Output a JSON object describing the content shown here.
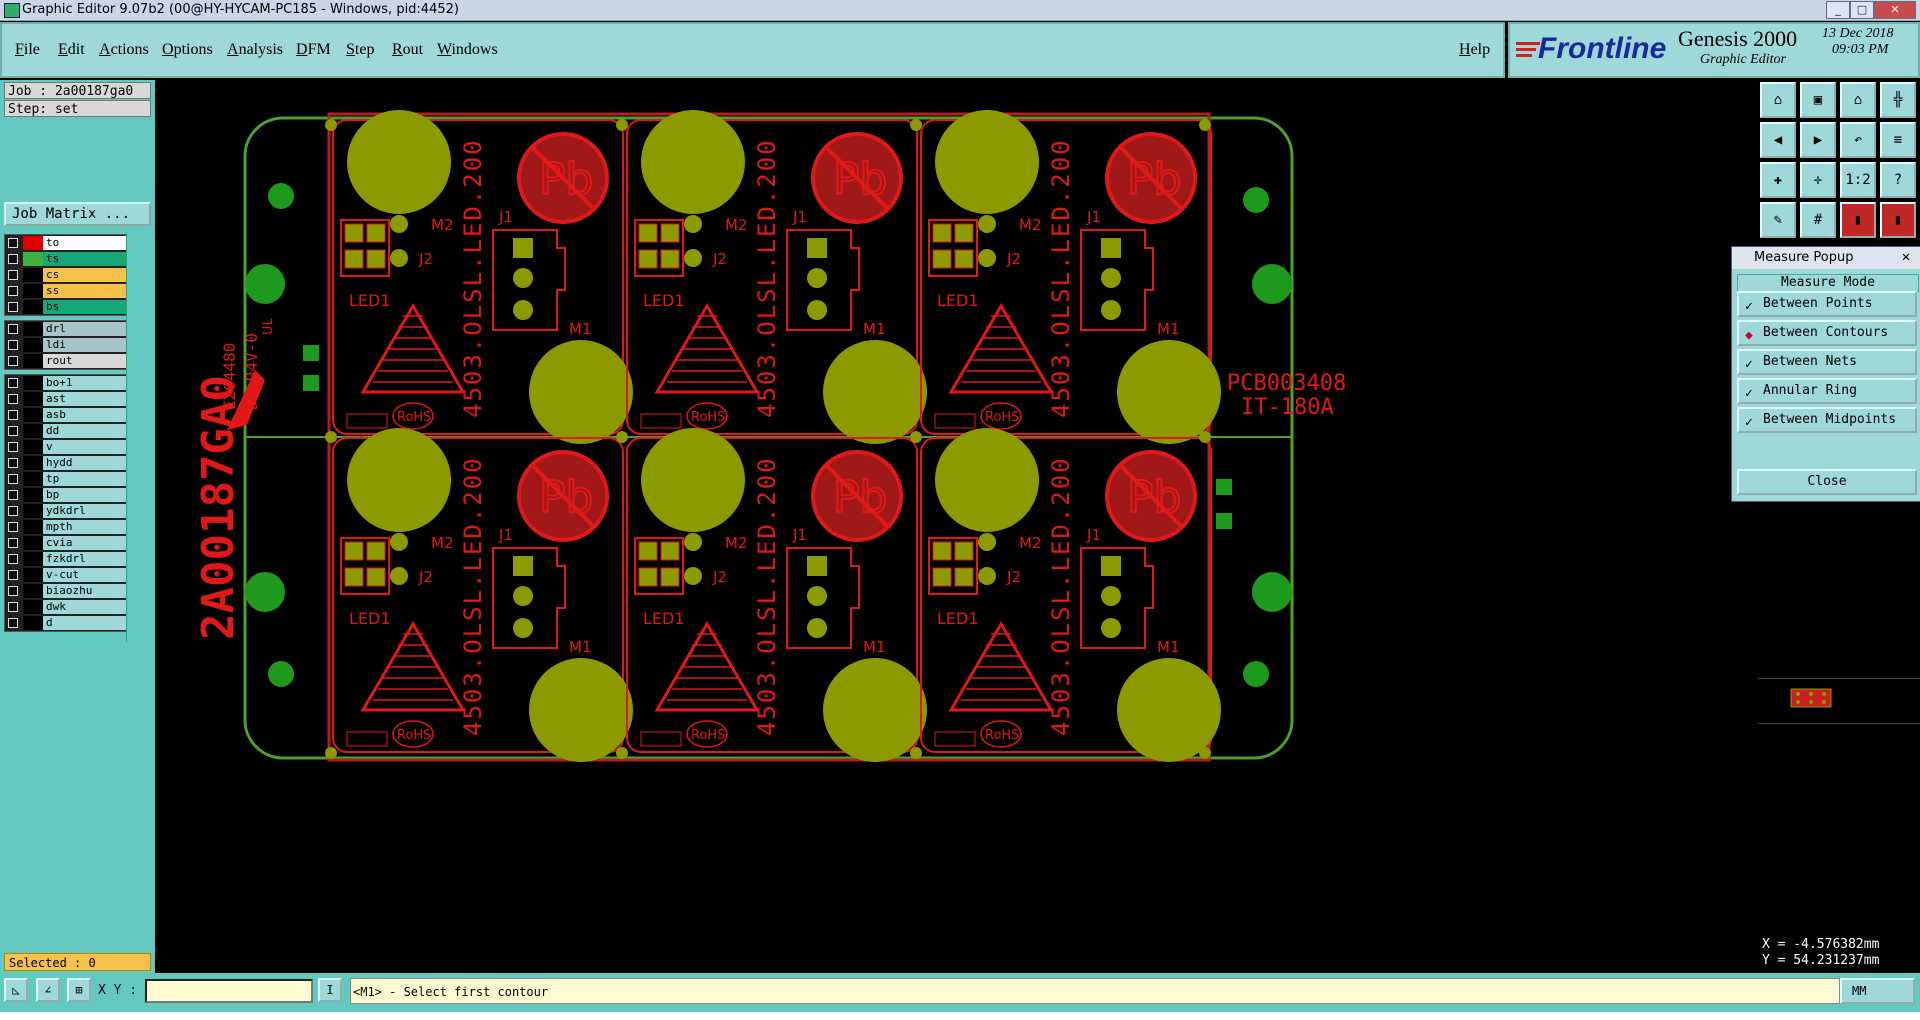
{
  "window": {
    "title": "Graphic Editor 9.07b2 (00@HY-HYCAM-PC185 - Windows, pid:4452)",
    "min_label": "_",
    "max_label": "□",
    "close_label": "✕"
  },
  "menu": {
    "items": [
      "File",
      "Edit",
      "Actions",
      "Options",
      "Analysis",
      "DFM",
      "Step",
      "Rout",
      "Windows"
    ],
    "help": "Help"
  },
  "brand": {
    "logo": "Frontline",
    "product": "Genesis 2000",
    "subtitle": "Graphic Editor",
    "date": "13 Dec 2018",
    "time": "09:03 PM"
  },
  "left": {
    "job": "Job : 2a00187ga0",
    "step": "Step: set",
    "job_matrix": "Job Matrix ...",
    "layers_top": [
      {
        "name": "to",
        "color": "#ffffff",
        "swatch": "#e00000"
      },
      {
        "name": "ts",
        "color": "#18a878",
        "swatch": "#40b040"
      },
      {
        "name": "cs",
        "color": "#f6c24c",
        "swatch": "#000000"
      },
      {
        "name": "ss",
        "color": "#f6c24c",
        "swatch": "#000000"
      },
      {
        "name": "bs",
        "color": "#18a878",
        "swatch": "#000000"
      }
    ],
    "layers_drill": [
      {
        "name": "drl",
        "color": "#a9c4c8",
        "swatch": "#000000"
      },
      {
        "name": "ldi",
        "color": "#a9c4c8",
        "swatch": "#000000"
      },
      {
        "name": "rout",
        "color": "#d8d8d8",
        "swatch": "#000000"
      }
    ],
    "layers_misc": [
      {
        "name": "bo+1",
        "color": "#9fd8d8",
        "swatch": "#000000"
      },
      {
        "name": "ast",
        "color": "#9fd8d8",
        "swatch": "#000000"
      },
      {
        "name": "asb",
        "color": "#9fd8d8",
        "swatch": "#000000"
      },
      {
        "name": "dd",
        "color": "#9fd8d8",
        "swatch": "#000000"
      },
      {
        "name": "v",
        "color": "#9fd8d8",
        "swatch": "#000000"
      },
      {
        "name": "hydd",
        "color": "#9fd8d8",
        "swatch": "#000000"
      },
      {
        "name": "tp",
        "color": "#9fd8d8",
        "swatch": "#000000"
      },
      {
        "name": "bp",
        "color": "#9fd8d8",
        "swatch": "#000000"
      },
      {
        "name": "ydkdrl",
        "color": "#9fd8d8",
        "swatch": "#000000"
      },
      {
        "name": "mpth",
        "color": "#9fd8d8",
        "swatch": "#000000"
      },
      {
        "name": "cvia",
        "color": "#9fd8d8",
        "swatch": "#000000"
      },
      {
        "name": "fzkdrl",
        "color": "#9fd8d8",
        "swatch": "#000000"
      },
      {
        "name": "v-cut",
        "color": "#9fd8d8",
        "swatch": "#000000"
      },
      {
        "name": "biaozhu",
        "color": "#9fd8d8",
        "swatch": "#000000"
      },
      {
        "name": "dwk",
        "color": "#9fd8d8",
        "swatch": "#000000"
      },
      {
        "name": "d",
        "color": "#9fd8d8",
        "swatch": "#000000"
      }
    ],
    "selected": "Selected : 0"
  },
  "board": {
    "vertical_text": "4503.OLSL.LED.200",
    "side_code": "2A00187GA0",
    "ul_lines": [
      "E204480",
      "D1 94V-0"
    ],
    "ul_mark": "UL",
    "pcb_no": "PCB003408",
    "material": "IT-180A",
    "m2": "M2",
    "j2": "J2",
    "j1": "J1",
    "m1": "M1",
    "led1": "LED1",
    "rohs": "RoHS",
    "pb": "Pb",
    "colors": {
      "copper": "#e01818",
      "pad": "#8c9a00",
      "outline": "#4da02a",
      "green": "#1d9a1d"
    }
  },
  "measure": {
    "title": "Measure Popup",
    "mode_label": "Measure Mode",
    "options": [
      "Between Points",
      "Between Contours",
      "Between Nets",
      "Annular Ring",
      "Between Midpoints"
    ],
    "active_index": 1,
    "close": "Close"
  },
  "coords": {
    "x": "X = -4.576382mm",
    "y": "Y = 54.231237mm"
  },
  "cmd": {
    "xy_label": "X Y :",
    "xy_value": "",
    "prompt": "<M1> - Select first contour",
    "units": "MM"
  }
}
